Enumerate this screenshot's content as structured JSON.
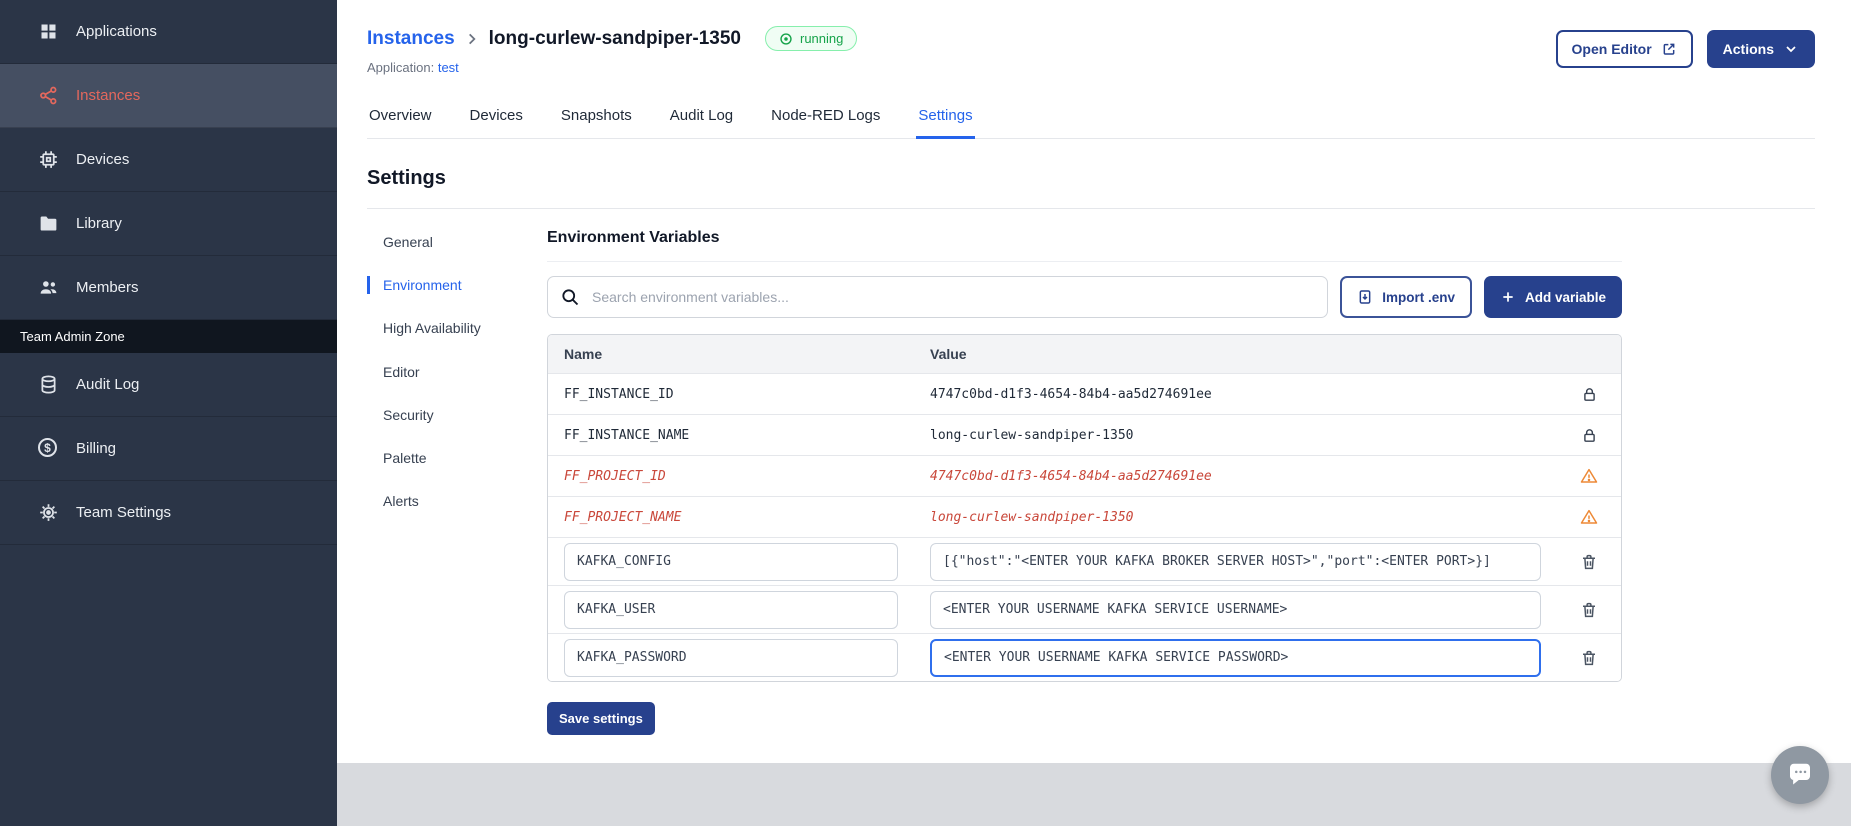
{
  "colors": {
    "primary_blue": "#2563eb",
    "navy_button": "#27418d",
    "sidebar_active_red": "#e4685d",
    "running_green": "#16a34a",
    "warning_orange": "#ed8936",
    "deprecated_red": "#c9473a"
  },
  "sidebar": {
    "items": [
      {
        "label": "Applications",
        "icon": "applications-icon"
      },
      {
        "label": "Instances",
        "icon": "instances-icon",
        "active": true
      },
      {
        "label": "Devices",
        "icon": "devices-icon"
      },
      {
        "label": "Library",
        "icon": "library-icon"
      },
      {
        "label": "Members",
        "icon": "members-icon"
      }
    ],
    "section_label": "Team Admin Zone",
    "admin_items": [
      {
        "label": "Audit Log",
        "icon": "audit-log-icon"
      },
      {
        "label": "Billing",
        "icon": "billing-icon"
      },
      {
        "label": "Team Settings",
        "icon": "team-settings-icon"
      }
    ]
  },
  "header": {
    "breadcrumb_root": "Instances",
    "instance_name": "long-curlew-sandpiper-1350",
    "status_badge": "running",
    "application_label": "Application:",
    "application_name": "test",
    "open_editor_label": "Open Editor",
    "actions_label": "Actions"
  },
  "tabs": {
    "items": [
      "Overview",
      "Devices",
      "Snapshots",
      "Audit Log",
      "Node-RED Logs",
      "Settings"
    ],
    "active": "Settings"
  },
  "settings": {
    "title": "Settings",
    "nav_items": [
      "General",
      "Environment",
      "High Availability",
      "Editor",
      "Security",
      "Palette",
      "Alerts"
    ],
    "active_nav": "Environment"
  },
  "environment": {
    "title": "Environment Variables",
    "search_placeholder": "Search environment variables...",
    "import_button_label": "Import .env",
    "add_button_label": "Add variable",
    "columns": [
      "Name",
      "Value"
    ],
    "rows": [
      {
        "name": "FF_INSTANCE_ID",
        "value": "4747c0bd-d1f3-4654-84b4-aa5d274691ee",
        "state": "locked"
      },
      {
        "name": "FF_INSTANCE_NAME",
        "value": "long-curlew-sandpiper-1350",
        "state": "locked"
      },
      {
        "name": "FF_PROJECT_ID",
        "value": "4747c0bd-d1f3-4654-84b4-aa5d274691ee",
        "state": "deprecated"
      },
      {
        "name": "FF_PROJECT_NAME",
        "value": "long-curlew-sandpiper-1350",
        "state": "deprecated"
      },
      {
        "name": "KAFKA_CONFIG",
        "value": "[{\"host\":\"<ENTER YOUR KAFKA BROKER SERVER HOST>\",\"port\":<ENTER PORT>}]",
        "state": "editable"
      },
      {
        "name": "KAFKA_USER",
        "value": "<ENTER YOUR USERNAME KAFKA SERVICE USERNAME>",
        "state": "editable"
      },
      {
        "name": "KAFKA_PASSWORD",
        "value": "<ENTER YOUR USERNAME KAFKA SERVICE PASSWORD>",
        "state": "editable",
        "focused": true
      }
    ],
    "save_button_label": "Save settings"
  }
}
